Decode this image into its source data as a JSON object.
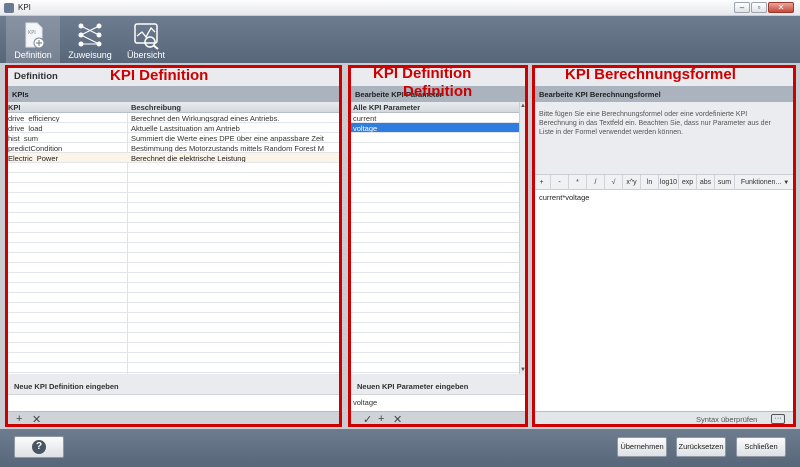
{
  "window": {
    "title": "KPI",
    "min": "‒",
    "max": "▫",
    "close": "✕"
  },
  "toolbar": {
    "items": [
      {
        "label": "Definition",
        "icon": "kpi-document-icon"
      },
      {
        "label": "Zuweisung",
        "icon": "network-assign-icon"
      },
      {
        "label": "Übersicht",
        "icon": "chart-overview-icon"
      }
    ]
  },
  "annotations": {
    "left": "KPI Definition",
    "middle_line1": "KPI Definition",
    "middle_line2": "Definition",
    "right": "KPI Berechnungsformel"
  },
  "left_panel": {
    "section_title": "Definition",
    "header": "KPIs",
    "columns": [
      "KPI",
      "Beschreibung"
    ],
    "rows": [
      [
        "drive_efficiency",
        "Berechnet den Wirkungsgrad eines Antriebs."
      ],
      [
        "drive_load",
        "Aktuelle Lastsituation am Antrieb"
      ],
      [
        "hist_sum",
        "Summiert die Werte eines DPE über eine anpassbare Zeit"
      ],
      [
        "predictCondition",
        "Bestimmung des Motorzustands mittels Random Forest M"
      ],
      [
        "Electric_Power",
        "Berechnet die elektrische Leistung"
      ]
    ],
    "new_label": "Neue KPI Definition eingeben",
    "new_value": "",
    "add": "+",
    "remove": "✕"
  },
  "middle_panel": {
    "header": "Bearbeite KPI Parameter",
    "column": "Alle KPI Parameter",
    "rows": [
      "current",
      "voltage"
    ],
    "selected_row": "voltage",
    "new_label": "Neuen KPI Parameter eingeben",
    "new_value": "voltage",
    "confirm": "✓",
    "add": "+",
    "remove": "✕"
  },
  "right_panel": {
    "header": "Bearbeite KPI Berechnungsformel",
    "info": "Bitte fügen Sie eine Berechnungsformel oder eine vordefinierte KPI Berechnung in das Textfeld ein. Beachten Sie, dass nur Parameter aus der Liste in der Formel verwendet werden können.",
    "calc_buttons": [
      "+",
      "-",
      "*",
      "/",
      "√",
      "x^y",
      "ln",
      "log10",
      "exp",
      "abs",
      "sum",
      "Funktionen..."
    ],
    "formula": "current*voltage",
    "syntax_check": "Syntax überprüfen",
    "more": "···"
  },
  "bottom": {
    "help": "?",
    "apply": "Übernehmen",
    "reset": "Zurücksetzen",
    "close": "Schließen"
  },
  "colors": {
    "accent_red": "#cc0000",
    "selection": "#2f7de1",
    "toolbar": "#627085"
  }
}
